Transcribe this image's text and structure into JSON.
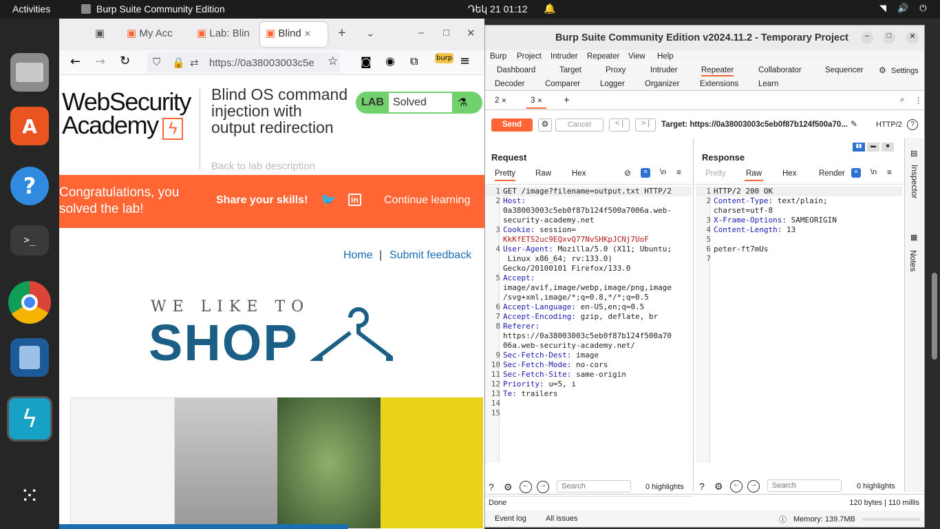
{
  "topbar": {
    "activities": "Activities",
    "app_name": "Burp Suite Community Edition",
    "clock": "Դեկ 21  01:12"
  },
  "browser": {
    "tabs": [
      {
        "label": "My Acc"
      },
      {
        "label": "Lab: Blin"
      },
      {
        "label": "Blind"
      }
    ],
    "url": "https://0a38003003c5e",
    "lab": {
      "title": "Blind OS command injection with output redirection",
      "status_label": "LAB",
      "status_value": "Solved",
      "back_link": "Back to lab description"
    },
    "logo": {
      "line1": "WebSecurity",
      "line2": "Academy"
    },
    "banner": {
      "congrats": "Congratulations, you solved the lab!",
      "share": "Share your skills!",
      "continue": "Continue learning"
    },
    "links": {
      "home": "Home",
      "sep": "|",
      "feedback": "Submit feedback"
    },
    "shop": {
      "tagline": "WE LIKE TO",
      "name": "SHOP"
    }
  },
  "burp": {
    "title": "Burp Suite Community Edition v2024.11.2 - Temporary Project",
    "menu": [
      "Burp",
      "Project",
      "Intruder",
      "Repeater",
      "View",
      "Help"
    ],
    "tabs_row1": [
      "Dashboard",
      "Target",
      "Proxy",
      "Intruder",
      "Repeater",
      "Collaborator",
      "Sequencer",
      "Settings"
    ],
    "tabs_row2": [
      "Decoder",
      "Comparer",
      "Logger",
      "Organizer",
      "Extensions",
      "Learn"
    ],
    "repeater_tabs": [
      "2",
      "3"
    ],
    "toolbar": {
      "send": "Send",
      "cancel": "Cancel",
      "target": "Target: https://0a38003003c5eb0f87b124f500a70...",
      "http": "HTTP/2"
    },
    "request": {
      "title": "Request",
      "views": [
        "Pretty",
        "Raw",
        "Hex"
      ],
      "newline": "\\n",
      "lines": [
        [
          "1",
          "GET /image?filename=output.txt HTTP/2"
        ],
        [
          "2",
          "Host:"
        ],
        [
          "",
          "0a38003003c5eb0f87b124f500a7006a.web-"
        ],
        [
          "",
          "security-academy.net"
        ],
        [
          "3",
          "Cookie: session="
        ],
        [
          "",
          "KkKfETS2uc9EQxvQ77NvSHKpJCNj7UoF"
        ],
        [
          "4",
          "User-Agent: Mozilla/5.0 (X11; Ubuntu;"
        ],
        [
          "",
          " Linux x86_64; rv:133.0)"
        ],
        [
          "",
          "Gecko/20100101 Firefox/133.0"
        ],
        [
          "5",
          "Accept:"
        ],
        [
          "",
          "image/avif,image/webp,image/png,image"
        ],
        [
          "",
          "/svg+xml,image/*;q=0.8,*/*;q=0.5"
        ],
        [
          "6",
          "Accept-Language: en-US,en;q=0.5"
        ],
        [
          "7",
          "Accept-Encoding: gzip, deflate, br"
        ],
        [
          "8",
          "Referer:"
        ],
        [
          "",
          "https://0a38003003c5eb0f87b124f500a70"
        ],
        [
          "",
          "06a.web-security-academy.net/"
        ],
        [
          "9",
          "Sec-Fetch-Dest: image"
        ],
        [
          "10",
          "Sec-Fetch-Mode: no-cors"
        ],
        [
          "11",
          "Sec-Fetch-Site: same-origin"
        ],
        [
          "12",
          "Priority: u=5, i"
        ],
        [
          "13",
          "Te: trailers"
        ],
        [
          "14",
          ""
        ],
        [
          "15",
          ""
        ]
      ],
      "search_placeholder": "Search",
      "highlights": "0 highlights"
    },
    "response": {
      "title": "Response",
      "views": [
        "Pretty",
        "Raw",
        "Hex",
        "Render"
      ],
      "newline": "\\n",
      "lines": [
        [
          "1",
          "HTTP/2 200 OK"
        ],
        [
          "2",
          "Content-Type: text/plain;"
        ],
        [
          "",
          "charset=utf-8"
        ],
        [
          "3",
          "X-Frame-Options: SAMEORIGIN"
        ],
        [
          "4",
          "Content-Length: 13"
        ],
        [
          "5",
          ""
        ],
        [
          "6",
          "peter-ft7mUs"
        ],
        [
          "7",
          ""
        ]
      ],
      "search_placeholder": "Search",
      "highlights": "0 highlights"
    },
    "side": [
      "Inspector",
      "Notes"
    ],
    "status": {
      "left": "Done",
      "right": "120 bytes | 110 millis"
    },
    "bottom": {
      "event_log": "Event log",
      "all_issues": "All issues",
      "memory": "Memory: 139.7MB"
    }
  }
}
